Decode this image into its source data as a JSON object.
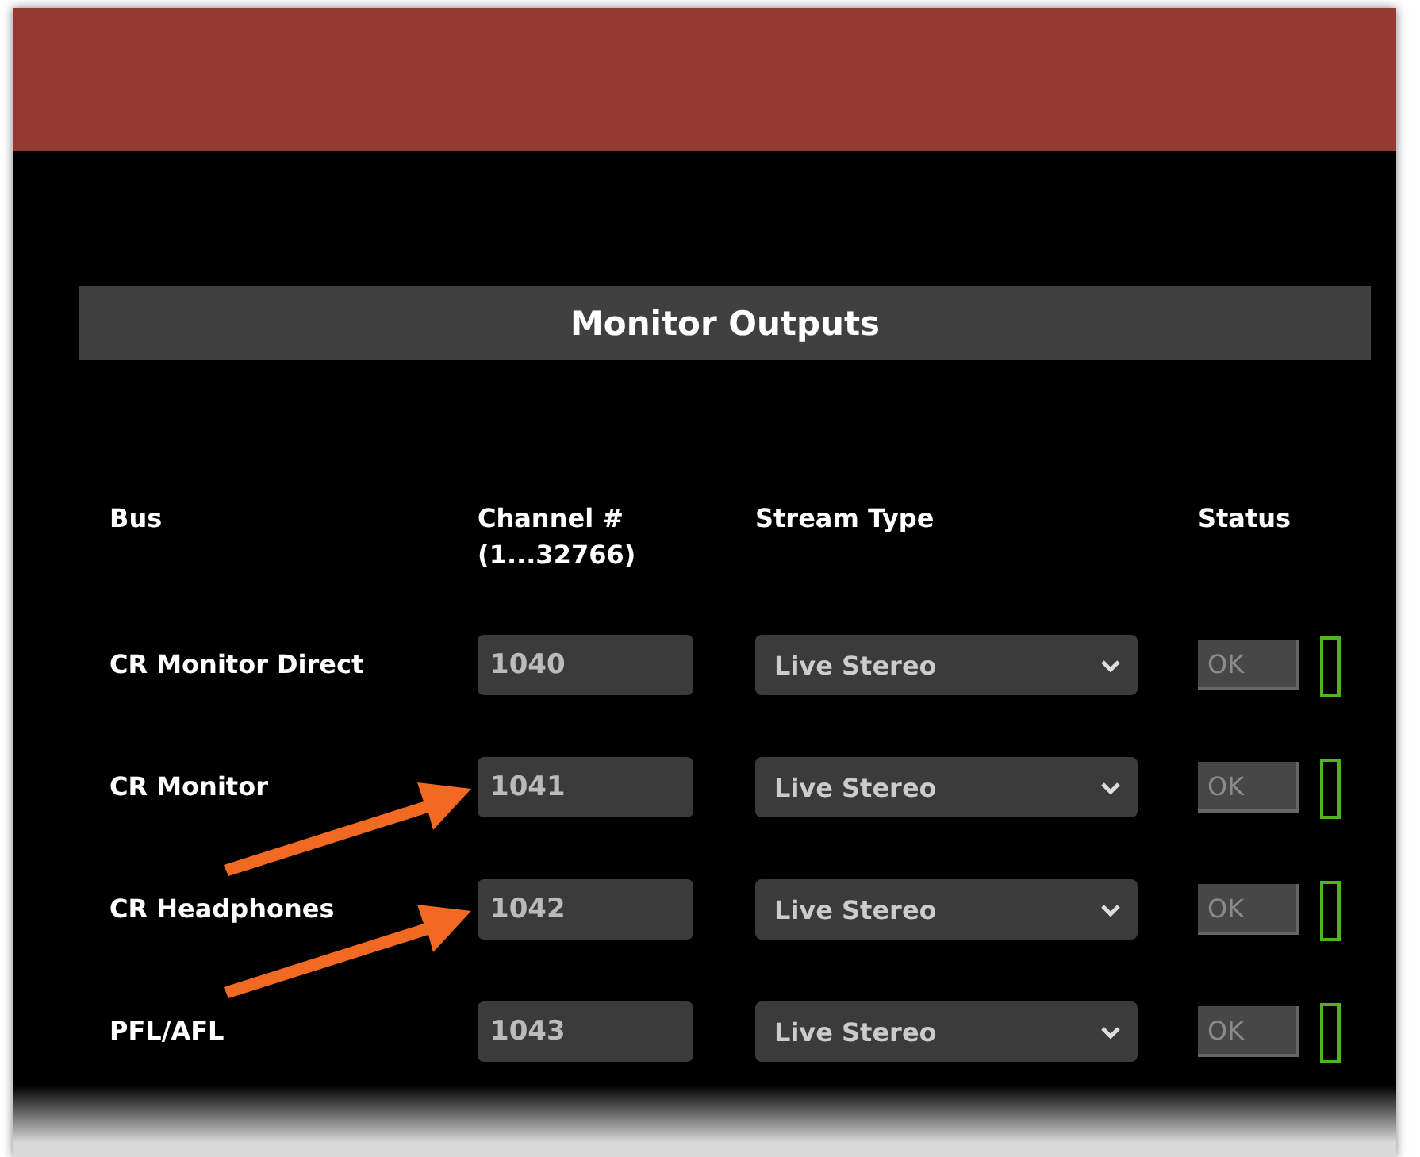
{
  "section_title": "Monitor Outputs",
  "columns": [
    "Bus",
    "Channel #\n(1...32766)",
    "Stream Type",
    "Status"
  ],
  "rows": [
    {
      "bus": "CR Monitor Direct",
      "channel": "1040",
      "stream_type": "Live Stereo",
      "status": "OK",
      "highlighted": false
    },
    {
      "bus": "CR Monitor",
      "channel": "1041",
      "stream_type": "Live Stereo",
      "status": "OK",
      "highlighted": true
    },
    {
      "bus": "CR Headphones",
      "channel": "1042",
      "stream_type": "Live Stereo",
      "status": "OK",
      "highlighted": true
    },
    {
      "bus": "PFL/AFL",
      "channel": "1043",
      "stream_type": "Live Stereo",
      "status": "OK",
      "highlighted": false
    }
  ]
}
